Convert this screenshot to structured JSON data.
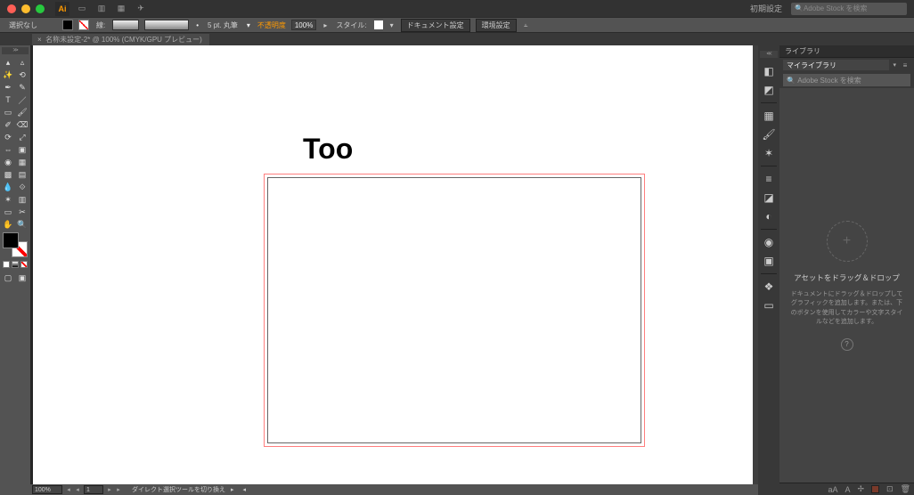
{
  "titlebar": {
    "app_abbrev": "Ai",
    "workspace_label": "初期設定",
    "search_icon": "🔍",
    "search_placeholder": "Adobe Stock を検索"
  },
  "control_bar": {
    "selection_label": "選択なし",
    "stroke_label": "線:",
    "stroke_style": "5 pt. 丸筆",
    "opacity_label": "不透明度",
    "opacity_value": "100%",
    "style_label": "スタイル:",
    "doc_setup": "ドキュメント設定",
    "prefs": "環境設定"
  },
  "document": {
    "tab_title": "名称未設定-2* @ 100% (CMYK/GPU プレビュー)",
    "canvas_text": "Too"
  },
  "status": {
    "zoom": "100%",
    "page": "1",
    "hint": "ダイレクト選択ツールを切り換え"
  },
  "library": {
    "header": "ライブラリ",
    "selected": "マイライブラリ",
    "search_placeholder": "Adobe Stock を検索",
    "drop_plus": "+",
    "title": "アセットをドラッグ＆ドロップ",
    "body": "ドキュメントにドラッグ＆ドロップしてグラフィックを追加します。または、下のボタンを使用してカラーや文字スタイルなどを追加します。",
    "info": "?"
  }
}
